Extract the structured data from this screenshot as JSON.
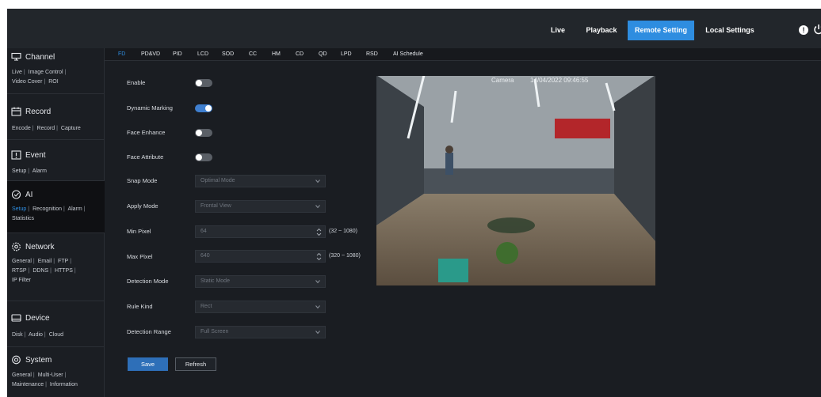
{
  "topbar": {
    "nav": [
      "Live",
      "Playback",
      "Remote Setting",
      "Local Settings"
    ],
    "info_icon": "!",
    "icons": [
      "info-icon",
      "power-icon"
    ]
  },
  "sidebar": {
    "sections": [
      {
        "title": "Channel",
        "icon": "channel-icon",
        "links": [
          "Live",
          "Image Control",
          "Video Cover",
          "ROI"
        ]
      },
      {
        "title": "Record",
        "icon": "record-icon",
        "links": [
          "Encode",
          "Record",
          "Capture"
        ]
      },
      {
        "title": "Event",
        "icon": "event-icon",
        "links": [
          "Setup",
          "Alarm"
        ]
      },
      {
        "title": "AI",
        "icon": "ai-icon",
        "links": [
          "Setup",
          "Recognition",
          "Alarm",
          "Statistics"
        ],
        "active": true
      },
      {
        "title": "Network",
        "icon": "network-icon",
        "links": [
          "General",
          "Email",
          "FTP",
          "RTSP",
          "DDNS",
          "HTTPS",
          "IP Filter"
        ]
      },
      {
        "title": "Device",
        "icon": "device-icon",
        "links": [
          "Disk",
          "Audio",
          "Cloud"
        ]
      },
      {
        "title": "System",
        "icon": "system-icon",
        "links": [
          "General",
          "Multi-User",
          "Maintenance",
          "Information"
        ]
      }
    ]
  },
  "tabs": [
    "FD",
    "PD&VD",
    "PID",
    "LCD",
    "SOD",
    "CC",
    "HM",
    "CD",
    "QD",
    "LPD",
    "RSD",
    "AI Schedule"
  ],
  "form": {
    "enable_label": "Enable",
    "enable": false,
    "dynamic_marking_label": "Dynamic Marking",
    "dynamic_marking": true,
    "face_enhance_label": "Face Enhance",
    "face_enhance": false,
    "face_attribute_label": "Face Attribute",
    "face_attribute": false,
    "snap_mode_label": "Snap Mode",
    "snap_mode": "Optimal Mode",
    "apply_mode_label": "Apply Mode",
    "apply_mode": "Frontal View",
    "min_pixel_label": "Min Pixel",
    "min_pixel": "64",
    "min_pixel_range": "(32 ~ 1080)",
    "max_pixel_label": "Max Pixel",
    "max_pixel": "640",
    "max_pixel_range": "(320 ~ 1080)",
    "detection_mode_label": "Detection Mode",
    "detection_mode": "Static Mode",
    "rule_kind_label": "Rule Kind",
    "rule_kind": "Rect",
    "detection_range_label": "Detection Range",
    "detection_range": "Full Screen"
  },
  "buttons": {
    "save": "Save",
    "refresh": "Refresh"
  },
  "preview": {
    "camera_name": "Camera",
    "timestamp": "14/04/2022 09:46:55"
  },
  "colors": {
    "accent": "#2e8de0",
    "background": "#1a1d22",
    "topbar": "#22262b",
    "toggle_on": "#3f7fcf"
  }
}
